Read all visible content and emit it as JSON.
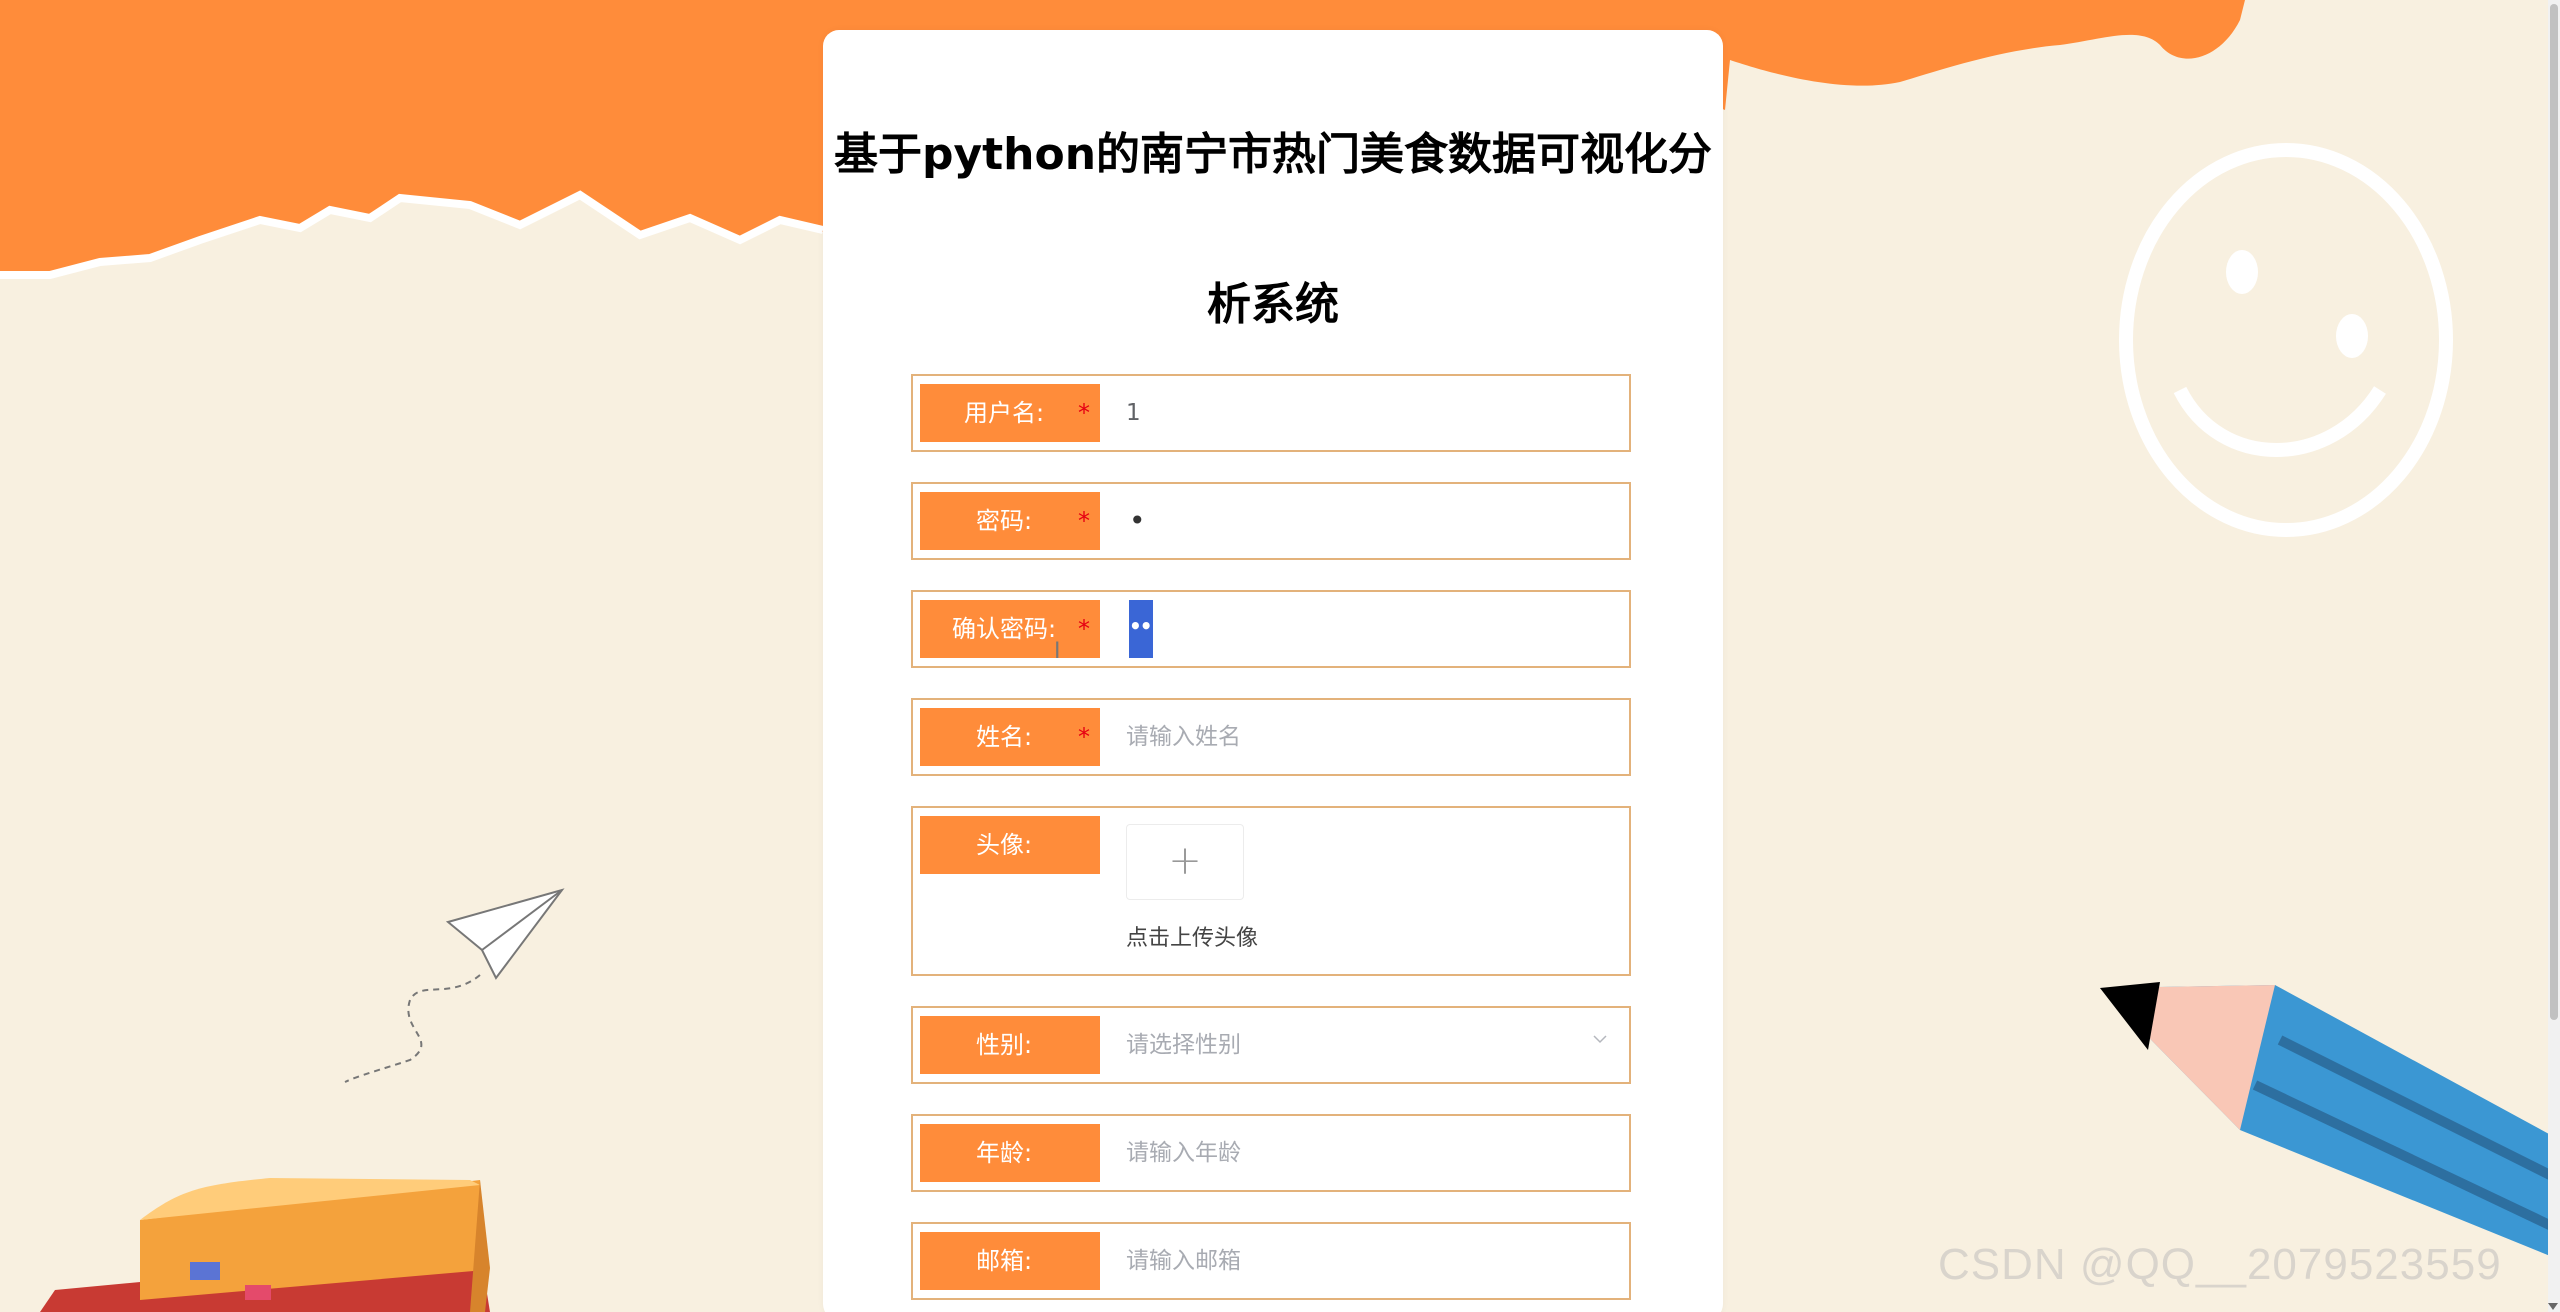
{
  "page": {
    "title": "基于python的南宁市热门美食数据可视化分析系统"
  },
  "form": {
    "username": {
      "label": "用户名:",
      "value": "1",
      "required": true
    },
    "password": {
      "label": "密码:",
      "value": "•",
      "required": true
    },
    "confirm_password": {
      "label": "确认密码:",
      "value": "•••",
      "required": true
    },
    "name": {
      "label": "姓名:",
      "placeholder": "请输入姓名",
      "required": true
    },
    "avatar": {
      "label": "头像:",
      "upload_icon": "+",
      "upload_text": "点击上传头像"
    },
    "gender": {
      "label": "性别:",
      "placeholder": "请选择性别",
      "icon": "chevron-down-icon"
    },
    "age": {
      "label": "年龄:",
      "placeholder": "请输入年龄"
    },
    "email": {
      "label": "邮箱:",
      "placeholder": "请输入邮箱"
    }
  },
  "required_mark": "*",
  "watermark": "CSDN @QQ__2079523559",
  "colors": {
    "accent": "#ff8c3a",
    "background": "#f8f0e0",
    "border": "#e3b27b",
    "required": "#e60012",
    "selection": "#3a66d6"
  }
}
